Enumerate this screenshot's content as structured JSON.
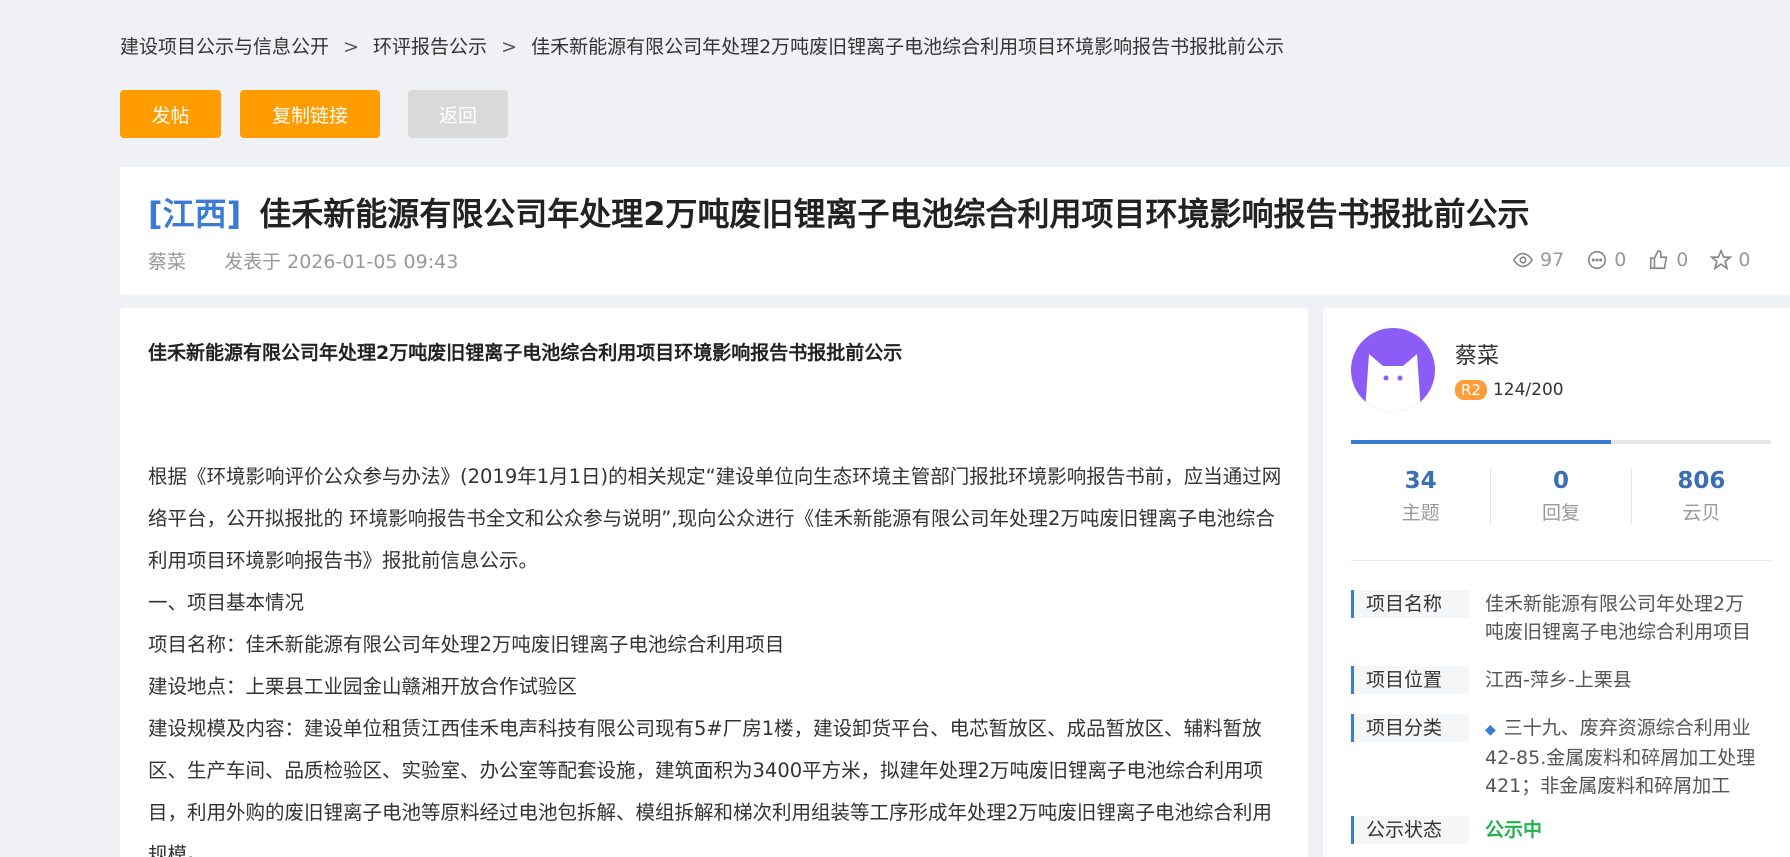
{
  "breadcrumb": {
    "items": [
      "建设项目公示与信息公开",
      "环评报告公示",
      "佳禾新能源有限公司年处理2万吨废旧锂离子电池综合利用项目环境影响报告书报批前公示"
    ],
    "separator": ">"
  },
  "actions": {
    "post": "发帖",
    "copy_link": "复制链接",
    "back": "返回"
  },
  "post": {
    "region": "[江西]",
    "title": "佳禾新能源有限公司年处理2万吨废旧锂离子电池综合利用项目环境影响报告书报批前公示",
    "author": "蔡菜",
    "published": "发表于 2026-01-05 09:43",
    "stats": {
      "views": "97",
      "comments": "0",
      "likes": "0",
      "favorites": "0"
    }
  },
  "article": {
    "heading": "佳禾新能源有限公司年处理2万吨废旧锂离子电池综合利用项目环境影响报告书报批前公示",
    "paragraphs": [
      "根据《环境影响评价公众参与办法》(2019年1月1日)的相关规定“建设单位向生态环境主管部门报批环境影响报告书前，应当通过网络平台，公开拟报批的 环境影响报告书全文和公众参与说明”,现向公众进行《佳禾新能源有限公司年处理2万吨废旧锂离子电池综合利用项目环境影响报告书》报批前信息公示。",
      "一、项目基本情况",
      "项目名称：佳禾新能源有限公司年处理2万吨废旧锂离子电池综合利用项目",
      "建设地点：上栗县工业园金山赣湘开放合作试验区",
      "建设规模及内容：建设单位租赁江西佳禾电声科技有限公司现有5#厂房1楼，建设卸货平台、电芯暂放区、成品暂放区、辅料暂放区、生产车间、品质检验区、实验室、办公室等配套设施，建筑面积为3400平方米，拟建年处理2万吨废旧锂离子电池综合利用项目，利用外购的废旧锂离子电池等原料经过电池包拆解、模组拆解和梯次利用组装等工序形成年处理2万吨废旧锂离子电池综合利用规模。"
    ]
  },
  "sidebar": {
    "user": {
      "name": "蔡菜",
      "level_badge": "R2",
      "level_progress": "124/200",
      "progress_fraction": 0.62
    },
    "counts": [
      {
        "num": "34",
        "label": "主题"
      },
      {
        "num": "0",
        "label": "回复"
      },
      {
        "num": "806",
        "label": "云贝"
      }
    ],
    "info": [
      {
        "label": "项目名称",
        "value": "佳禾新能源有限公司年处理2万吨废旧锂离子电池综合利用项目"
      },
      {
        "label": "项目位置",
        "value": "江西-萍乡-上栗县"
      },
      {
        "label": "项目分类",
        "value": "三十九、废弃资源综合利用业42-85.金属废料和碎屑加工处理421；非金属废料和碎屑加工处..."
      },
      {
        "label": "公示状态",
        "value": "公示中"
      }
    ]
  },
  "colors": {
    "accent_orange": "#ff9c00",
    "accent_blue": "#3a7bd5",
    "status_green": "#22b14c",
    "avatar_purple": "#8b5cf6"
  }
}
